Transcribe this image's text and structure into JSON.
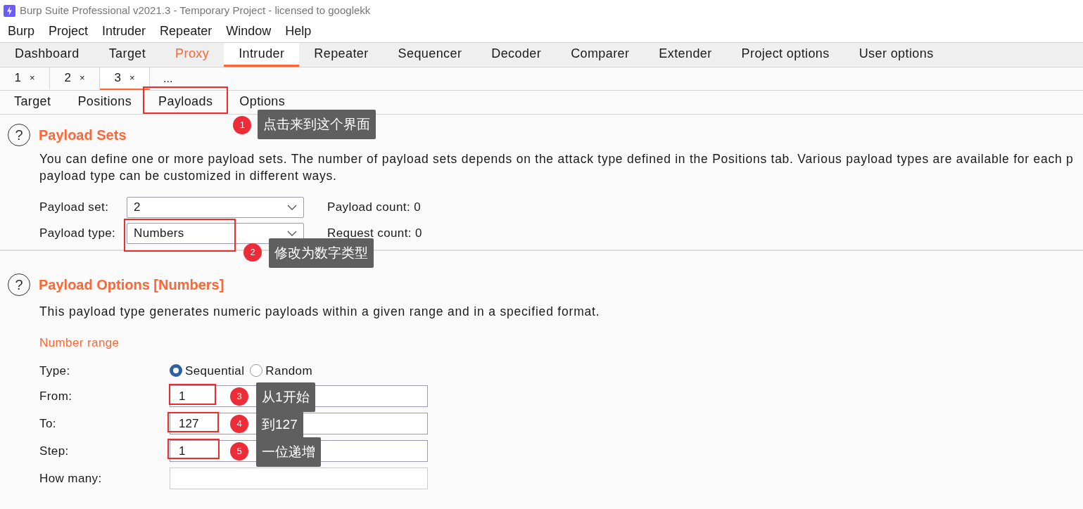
{
  "window": {
    "title": "Burp Suite Professional v2021.3 - Temporary Project - licensed to googlekk"
  },
  "menu": [
    "Burp",
    "Project",
    "Intruder",
    "Repeater",
    "Window",
    "Help"
  ],
  "main_tabs": [
    {
      "label": "Dashboard",
      "selected": false,
      "highlighted": false
    },
    {
      "label": "Target",
      "selected": false,
      "highlighted": false
    },
    {
      "label": "Proxy",
      "selected": false,
      "highlighted": true
    },
    {
      "label": "Intruder",
      "selected": true,
      "highlighted": false
    },
    {
      "label": "Repeater",
      "selected": false,
      "highlighted": false
    },
    {
      "label": "Sequencer",
      "selected": false,
      "highlighted": false
    },
    {
      "label": "Decoder",
      "selected": false,
      "highlighted": false
    },
    {
      "label": "Comparer",
      "selected": false,
      "highlighted": false
    },
    {
      "label": "Extender",
      "selected": false,
      "highlighted": false
    },
    {
      "label": "Project options",
      "selected": false,
      "highlighted": false
    },
    {
      "label": "User options",
      "selected": false,
      "highlighted": false
    }
  ],
  "attack_tabs": [
    {
      "label": "1",
      "close": "×",
      "selected": false
    },
    {
      "label": "2",
      "close": "×",
      "selected": false
    },
    {
      "label": "3",
      "close": "×",
      "selected": true
    }
  ],
  "attack_tabs_more": "...",
  "sub_tabs": [
    {
      "label": "Target",
      "selected": false
    },
    {
      "label": "Positions",
      "selected": false
    },
    {
      "label": "Payloads",
      "selected": true
    },
    {
      "label": "Options",
      "selected": false
    }
  ],
  "payload_sets": {
    "help_icon": "?",
    "title": "Payload Sets",
    "description": "You can define one or more payload sets. The number of payload sets depends on the attack type defined in the Positions tab. Various payload types are available for each p\npayload type can be customized in different ways.",
    "fields": [
      {
        "label": "Payload set:",
        "value": "2",
        "info": "Payload count: 0"
      },
      {
        "label": "Payload type:",
        "value": "Numbers",
        "info": "Request count: 0"
      }
    ]
  },
  "payload_options": {
    "help_icon": "?",
    "title": "Payload Options [Numbers]",
    "description": "This payload type generates numeric payloads within a given range and in a specified format.",
    "subheading": "Number range",
    "type_label": "Type:",
    "type_options": [
      {
        "label": "Sequential",
        "selected": true
      },
      {
        "label": "Random",
        "selected": false
      }
    ],
    "fields": [
      {
        "label": "From:",
        "value": "1"
      },
      {
        "label": "To:",
        "value": "127"
      },
      {
        "label": "Step:",
        "value": "1"
      },
      {
        "label": "How many:"
      }
    ]
  },
  "annotations": [
    {
      "number": "1",
      "text": "点击来到这个界面"
    },
    {
      "number": "2",
      "text": "修改为数字类型"
    },
    {
      "number": "3",
      "text": "从1开始"
    },
    {
      "number": "4",
      "text": "到127"
    },
    {
      "number": "5",
      "text": "一位递增"
    }
  ]
}
